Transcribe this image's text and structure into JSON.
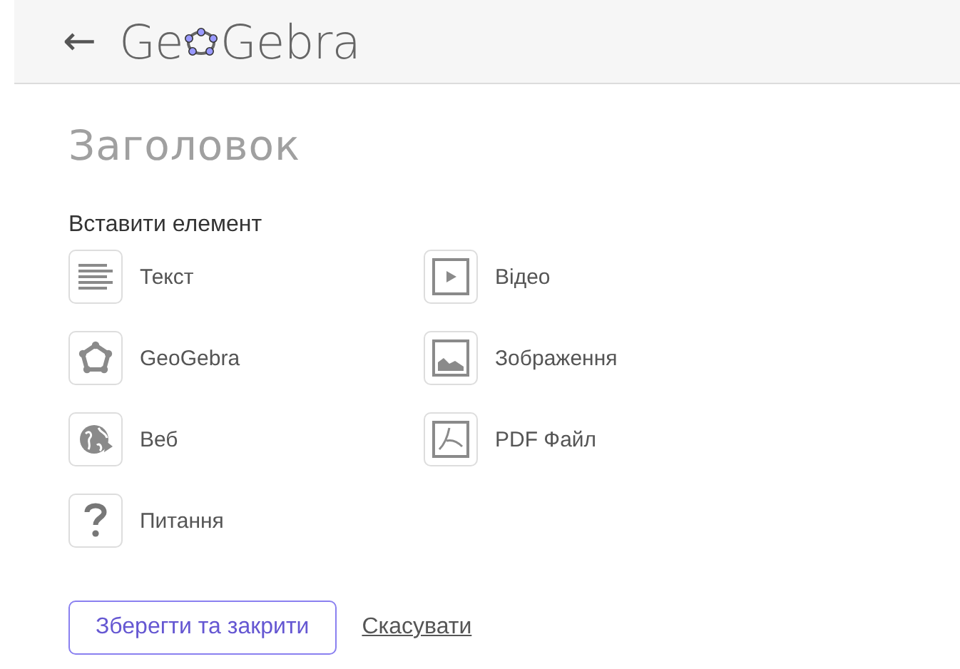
{
  "header": {
    "back": "←",
    "logo_start": "Ge",
    "logo_end": "Gebra"
  },
  "title_placeholder": "Заголовок",
  "insert_heading": "Вставити елемент",
  "elements": [
    {
      "kind": "text",
      "label": "Текст"
    },
    {
      "kind": "video",
      "label": "Відео"
    },
    {
      "kind": "geogebra",
      "label": "GeoGebra"
    },
    {
      "kind": "image",
      "label": "Зображення"
    },
    {
      "kind": "web",
      "label": "Веб"
    },
    {
      "kind": "pdf",
      "label": "PDF Файл"
    },
    {
      "kind": "question",
      "label": "Питання"
    }
  ],
  "save_button": "Зберегти та закрити",
  "cancel_link": "Скасувати"
}
